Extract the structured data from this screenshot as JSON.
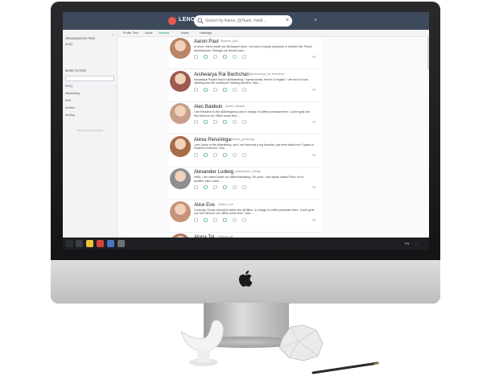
{
  "app": {
    "name": "LENORM",
    "search_placeholder": "Search by Name, @Team, #skill..."
  },
  "subnav": [
    {
      "label": "Profile Time"
    },
    {
      "label": "Inside"
    },
    {
      "label": "Persons"
    },
    {
      "label": "Teams"
    },
    {
      "label": "Hashtags"
    }
  ],
  "sidebar": {
    "org_title": "ORGANIZATION TREE",
    "org_items": [
      "#FAQ"
    ],
    "filters_title": "MORE FILTERS",
    "filter_items": [
      "#FAQ",
      "#Marketing",
      "#HR",
      "#coffee",
      "#noitop"
    ],
    "footer": "Powered with ♥ by lenorm"
  },
  "people": [
    {
      "name": "Aaron Paul",
      "handle": "@aaron_paul",
      "bio": "In short, intern inside our @Support team. I've been a kayak champion in another life. Proud #homeplanet. Perhaps we should have ...",
      "avatar_color": "#b98565"
    },
    {
      "name": "Aishwarya Rai Bachchan",
      "handle": "@aishwarya_rai_bachchan",
      "bio": "Nowadays Project lead in @Marketing. I speak arabic, french & english. I am fond of rock climbing and am looking for training partners. Also, ...",
      "avatar_color": "#9c5b4e"
    },
    {
      "name": "Alec Baldwin",
      "handle": "@alec_baldwin",
      "bio": "I am Resident to the @Emergency and in charge of coffee purchase there. Come grab one fine blend in our Office some time ...",
      "avatar_color": "#c9a08a"
    },
    {
      "name": "Alexa PenaVega",
      "handle": "@alexa_penavega",
      "bio": "I am Junior in the #Marketing, and I am foremost a big traveller, just went back from 3 years in Southern America. Plus ...",
      "avatar_color": "#a86b4a"
    },
    {
      "name": "Alexander Ludwig",
      "handle": "@alexander_ludwig",
      "bio": "Hello, I am intern inside our #Merchandising. Oh yeah: I can speak arabic! Plus: I'm in #coffee, also I want ...",
      "avatar_color": "#8e8e8e"
    },
    {
      "name": "Alice Eve",
      "handle": "@alice_eve",
      "bio": "Currently, Senior executive within the @Office. In charge of coffee purchase there. Come grab one fine blend in our Office some time ; Just ...",
      "avatar_color": "#c79479"
    },
    {
      "name": "Alona Tal",
      "handle": "@alona_tal",
      "bio": "",
      "avatar_color": "#b07b60"
    }
  ],
  "colors": {
    "topbar": "#3d4a5c",
    "accent": "#1f9d55",
    "brand": "#e85a4f"
  },
  "taskbar": {
    "lang": "FR",
    "clock": "..."
  }
}
